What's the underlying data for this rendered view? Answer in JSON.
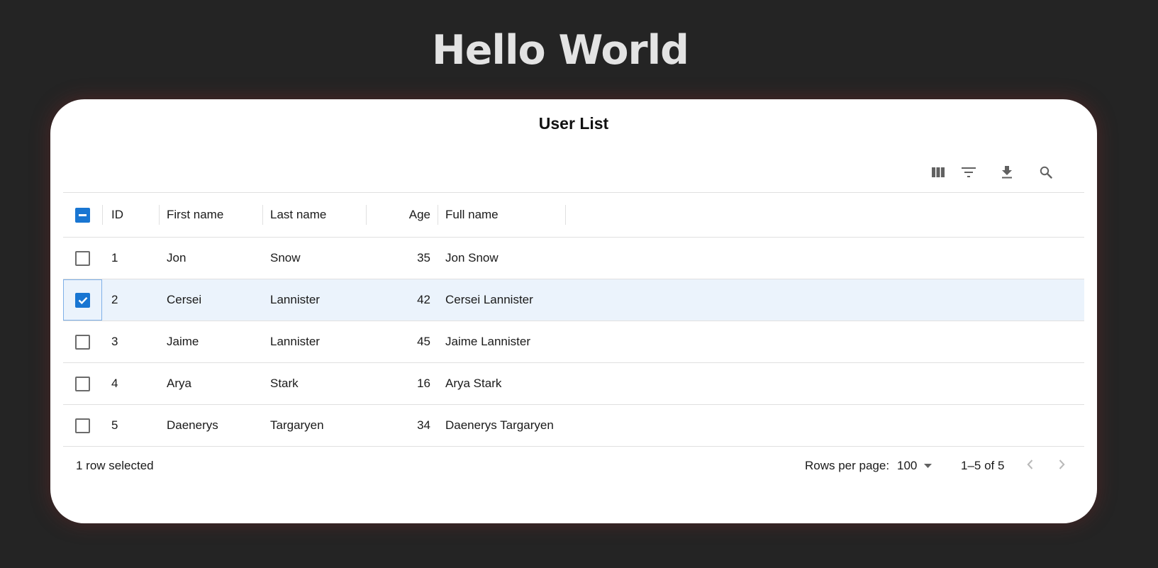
{
  "page": {
    "title": "Hello World"
  },
  "card": {
    "title": "User List"
  },
  "toolbar": {
    "icons": [
      "columns-icon",
      "filter-icon",
      "download-icon",
      "search-icon"
    ]
  },
  "columns": {
    "id": "ID",
    "first_name": "First name",
    "last_name": "Last name",
    "age": "Age",
    "full_name": "Full name"
  },
  "rows": [
    {
      "id": "1",
      "first": "Jon",
      "last": "Snow",
      "age": "35",
      "full": "Jon Snow",
      "checked": false
    },
    {
      "id": "2",
      "first": "Cersei",
      "last": "Lannister",
      "age": "42",
      "full": "Cersei Lannister",
      "checked": true
    },
    {
      "id": "3",
      "first": "Jaime",
      "last": "Lannister",
      "age": "45",
      "full": "Jaime Lannister",
      "checked": false
    },
    {
      "id": "4",
      "first": "Arya",
      "last": "Stark",
      "age": "16",
      "full": "Arya Stark",
      "checked": false
    },
    {
      "id": "5",
      "first": "Daenerys",
      "last": "Targaryen",
      "age": "34",
      "full": "Daenerys Targaryen",
      "checked": false
    }
  ],
  "footer": {
    "selected_text": "1 row selected",
    "rows_per_page_label": "Rows per page:",
    "rows_per_page_value": "100",
    "range_text": "1–5 of 5"
  },
  "colors": {
    "background": "#242424",
    "accent": "#1976d2",
    "selected_row": "#ebf3fc",
    "title_text": "#e3e3e3"
  }
}
